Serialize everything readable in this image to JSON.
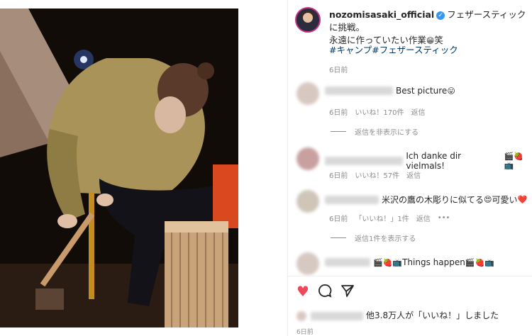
{
  "post": {
    "username": "nozomisasaki_official",
    "caption_line1": "フェザースティックに挑戦。",
    "caption_line2": "永遠に作っていたい作業",
    "caption_emoji": "😁",
    "caption_suffix": "笑",
    "hashtags": "#キャンプ#フェザースティック",
    "time": "6日前"
  },
  "comments": [
    {
      "text": "Best picture",
      "emoji": "😛",
      "time": "6日前",
      "likes": "いいね！170件",
      "reply": "返信"
    },
    {
      "hide_label": "返信を非表示にする"
    },
    {
      "text": "Ich danke dir vielmals!",
      "emoji": "🎬🍓📺",
      "time": "6日前",
      "likes": "いいね！57件",
      "reply": "返信"
    },
    {
      "text": "米沢の鷹の木彫りに似てる",
      "emoji_mid": "😍",
      "text2": "可愛い",
      "emoji_end": "❤️",
      "time": "6日前",
      "likes": "「いいね！」1件",
      "reply": "返信",
      "more": "•••"
    },
    {
      "show_label": "返信1件を表示する"
    },
    {
      "emoji_pre": "🎬🍓📺",
      "text": "Things happen",
      "emoji": "🎬🍓📺"
    }
  ],
  "actions": {
    "like_icon": "heart-icon",
    "comment_icon": "comment-icon",
    "share_icon": "share-icon"
  },
  "likes_summary": "他3.8万人が「いいね！」しました",
  "post_time": "6日前",
  "colors": {
    "verified": "#3897f0",
    "heart": "#ed4956",
    "link": "#00376b",
    "muted": "#8e8e8e"
  }
}
